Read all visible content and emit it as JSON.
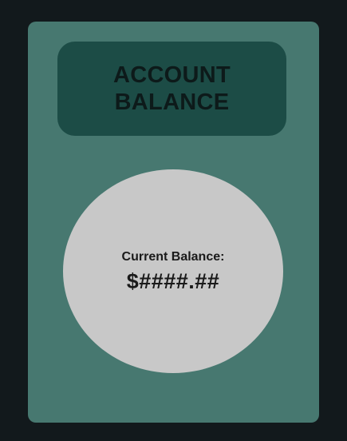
{
  "header": {
    "title": "ACCOUNT BALANCE"
  },
  "balance": {
    "label": "Current Balance:",
    "value": "$####.##"
  },
  "colors": {
    "background": "#12191c",
    "card": "#477870",
    "header": "#1c4c46",
    "circle": "#c8c8c8"
  }
}
